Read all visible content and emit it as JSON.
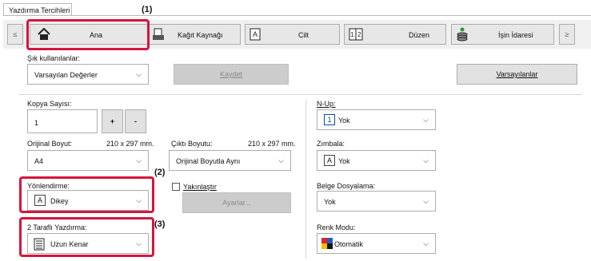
{
  "window": {
    "tab_title": "Yazdırma Tercihleri"
  },
  "toolbar": {
    "scroll_left": "≤",
    "scroll_right": "≥",
    "tabs": [
      {
        "label": "Ana",
        "icon": "home-icon"
      },
      {
        "label": "Kağıt Kaynağı",
        "icon": "paper-source-icon"
      },
      {
        "label": "Cilt",
        "icon": "binding-icon"
      },
      {
        "label": "Düzen",
        "icon": "layout-icon"
      },
      {
        "label": "İşin İdaresi",
        "icon": "job-handling-icon"
      }
    ]
  },
  "favorites": {
    "label": "Şık kullanılanlar:",
    "value": "Varsayılan Değerler",
    "save": "Kaydet",
    "defaults": "Varsayılanlar"
  },
  "copies": {
    "label": "Kopya Sayısı:",
    "value": "1",
    "plus": "+",
    "minus": "-"
  },
  "original_size": {
    "label": "Orijinal Boyut:",
    "dims": "210 x 297 mm.",
    "value": "A4"
  },
  "output_size": {
    "label": "Çıktı Boyutu:",
    "dims": "210 x 297 mm.",
    "value": "Orijinal Boyutla Aynı"
  },
  "orientation": {
    "label": "Yönlendirme:",
    "value": "Dikey",
    "icon_letter": "A"
  },
  "zoom": {
    "label": "Yakınlaştır",
    "settings": "Ayarlar..."
  },
  "duplex": {
    "label": "2 Taraflı Yazdırma:",
    "value": "Uzun Kenar"
  },
  "nup": {
    "label": "N-Up:",
    "value": "Yok",
    "icon_text": "1"
  },
  "staple": {
    "label": "Zımbala:",
    "value": "Yok",
    "icon_letter": "A"
  },
  "filing": {
    "label": "Belge Dosyalama:",
    "value": "Yok"
  },
  "color_mode": {
    "label": "Renk Modu:",
    "value": "Otomatik"
  },
  "callouts": {
    "c1": "(1)",
    "c2": "(2)",
    "c3": "(3)"
  },
  "colors": {
    "highlight": "#d4163c",
    "border": "#adadad"
  }
}
